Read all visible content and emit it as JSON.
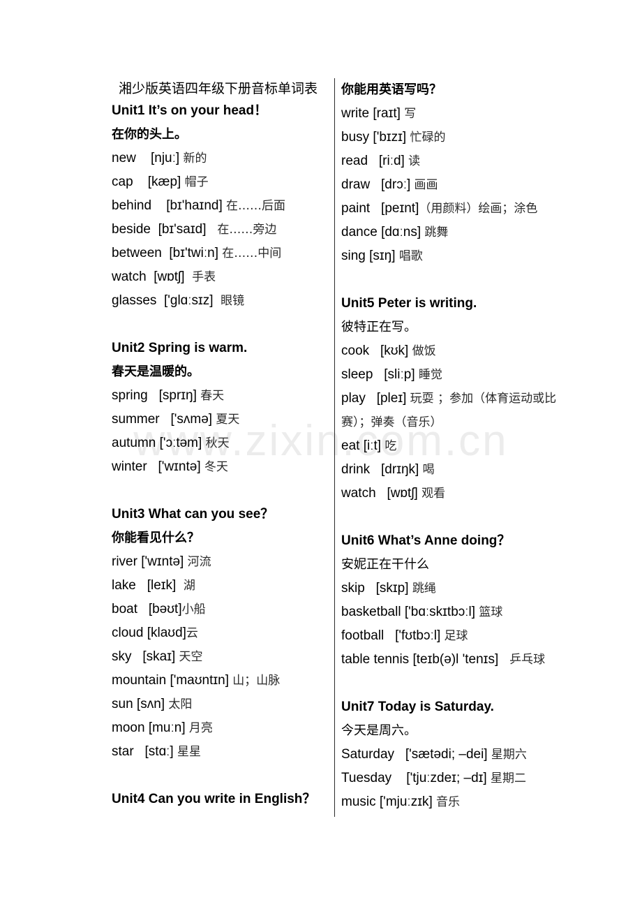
{
  "document": {
    "title": "湘少版英语四年级下册音标单词表",
    "watermark": "www.zixin.com.cn"
  },
  "left_column": {
    "units": [
      {
        "heading": "Unit1    It’s on your head！",
        "translation": "在你的头上。",
        "entries": [
          {
            "word": "new",
            "ipa": "[njuː]",
            "cn": "新的"
          },
          {
            "word": "cap",
            "ipa": "[kæp]",
            "cn": "帽子"
          },
          {
            "word": "behind",
            "ipa": "[bɪ'haɪnd]",
            "cn": "在……后面"
          },
          {
            "word": "beside",
            "ipa": "[bɪ'saɪd]",
            "cn": "在……旁边"
          },
          {
            "word": "between",
            "ipa": "[bɪ'twiːn]",
            "cn": "在……中间"
          },
          {
            "word": "watch",
            "ipa": "[wɒtʃ]",
            "cn": "手表"
          },
          {
            "word": "glasses",
            "ipa": "['glɑːsɪz]",
            "cn": "眼镜"
          }
        ]
      },
      {
        "heading": "Unit2    Spring is warm.",
        "translation": "春天是温暖的。",
        "entries": [
          {
            "word": "spring",
            "ipa": "[sprɪŋ]",
            "cn": "春天"
          },
          {
            "word": "summer",
            "ipa": "['sʌmə]",
            "cn": "夏天"
          },
          {
            "word": "autumn",
            "ipa": "['ɔːtəm]",
            "cn": "秋天"
          },
          {
            "word": "winter",
            "ipa": "['wɪntə]",
            "cn": "冬天"
          }
        ]
      },
      {
        "heading": "Unit3    What can you see？",
        "translation": "你能看见什么？",
        "entries": [
          {
            "word": "river",
            "ipa": "['wɪntə]",
            "cn": "河流"
          },
          {
            "word": "lake",
            "ipa": "[leɪk]",
            "cn": "湖"
          },
          {
            "word": "boat",
            "ipa": "[bəʊt]",
            "cn": "小船"
          },
          {
            "word": "cloud",
            "ipa": "[klaʊd]",
            "cn": "云"
          },
          {
            "word": "sky",
            "ipa": "[skaɪ]",
            "cn": "天空"
          },
          {
            "word": "mountain",
            "ipa": "['maʊntɪn]",
            "cn": "山；山脉"
          },
          {
            "word": "sun",
            "ipa": "[sʌn]",
            "cn": "太阳"
          },
          {
            "word": "moon",
            "ipa": "[muːn]",
            "cn": "月亮"
          },
          {
            "word": "star",
            "ipa": "[stɑː]",
            "cn": "星星"
          }
        ]
      },
      {
        "heading": "Unit4    Can you write in English？",
        "translation": "",
        "entries": []
      }
    ]
  },
  "right_column": {
    "units": [
      {
        "heading": "",
        "translation": "你能用英语写吗？",
        "entries": [
          {
            "word": "write",
            "ipa": "[raɪt]",
            "cn": "写"
          },
          {
            "word": "busy",
            "ipa": "['bɪzɪ]",
            "cn": "忙碌的"
          },
          {
            "word": "read",
            "ipa": "[riːd]",
            "cn": "读"
          },
          {
            "word": "draw",
            "ipa": "[drɔː]",
            "cn": "画画"
          },
          {
            "word": "paint",
            "ipa": "[peɪnt]",
            "cn": "（用颜料）绘画；涂色"
          },
          {
            "word": "dance",
            "ipa": "[dɑːns]",
            "cn": "跳舞"
          },
          {
            "word": "sing",
            "ipa": "[sɪŋ]",
            "cn": "唱歌"
          }
        ]
      },
      {
        "heading": "Unit5    Peter is writing.",
        "translation": "彼特正在写。",
        "entries": [
          {
            "word": "cook",
            "ipa": "[kʊk]",
            "cn": "做饭"
          },
          {
            "word": "sleep",
            "ipa": "[sliːp]",
            "cn": "睡觉"
          },
          {
            "word": "play",
            "ipa": "[pleɪ]",
            "cn": "玩耍 ；参加（体育运动或比赛）；弹奏（音乐）"
          },
          {
            "word": "eat",
            "ipa": "[iːt]",
            "cn": "吃"
          },
          {
            "word": "drink",
            "ipa": "[drɪŋk]",
            "cn": "喝"
          },
          {
            "word": "watch",
            "ipa": "[wɒtʃ]",
            "cn": "观看"
          }
        ]
      },
      {
        "heading": "Unit6    What’s Anne doing？",
        "translation": "安妮正在干什么",
        "entries": [
          {
            "word": "skip",
            "ipa": "[skɪp]",
            "cn": "跳绳"
          },
          {
            "word": "basketball",
            "ipa": "['bɑːskɪtbɔːl]",
            "cn": "篮球"
          },
          {
            "word": "football",
            "ipa": "['fʊtbɔːl]",
            "cn": "足球"
          },
          {
            "word": "table tennis",
            "ipa": "[teɪb(ə)l 'tenɪs]",
            "cn": "乒乓球"
          }
        ]
      },
      {
        "heading": "Unit7    Today is Saturday.",
        "translation": "今天是周六。",
        "entries": [
          {
            "word": "Saturday",
            "ipa": "['sætədi; –dei]",
            "cn": "星期六"
          },
          {
            "word": "Tuesday",
            "ipa": "['tjuːzdeɪ; –dɪ]",
            "cn": "星期二"
          },
          {
            "word": "music",
            "ipa": "['mjuːzɪk]",
            "cn": "音乐"
          }
        ]
      }
    ]
  }
}
